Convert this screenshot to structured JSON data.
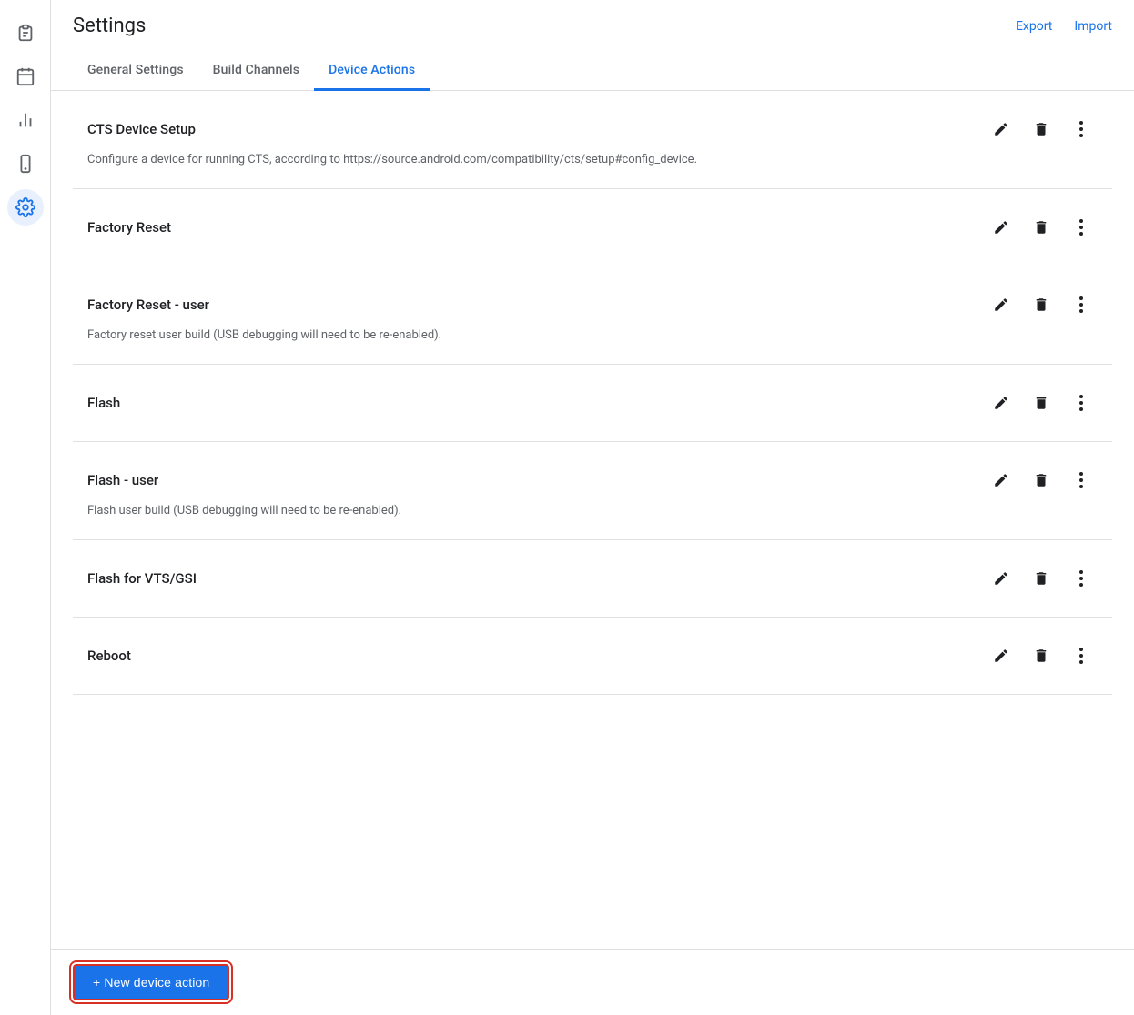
{
  "header": {
    "title": "Settings",
    "export_label": "Export",
    "import_label": "Import"
  },
  "tabs": [
    {
      "id": "general",
      "label": "General Settings",
      "active": false
    },
    {
      "id": "build-channels",
      "label": "Build Channels",
      "active": false
    },
    {
      "id": "device-actions",
      "label": "Device Actions",
      "active": true
    }
  ],
  "sidebar": {
    "icons": [
      {
        "id": "clipboard",
        "symbol": "📋",
        "active": false
      },
      {
        "id": "calendar",
        "symbol": "📅",
        "active": false
      },
      {
        "id": "chart",
        "symbol": "📊",
        "active": false
      },
      {
        "id": "phone",
        "symbol": "📱",
        "active": false
      },
      {
        "id": "settings",
        "symbol": "⚙",
        "active": true
      }
    ]
  },
  "device_actions": [
    {
      "id": "cts-device-setup",
      "title": "CTS Device Setup",
      "description": "Configure a device for running CTS, according to https://source.android.com/compatibility/cts/setup#config_device."
    },
    {
      "id": "factory-reset",
      "title": "Factory Reset",
      "description": ""
    },
    {
      "id": "factory-reset-user",
      "title": "Factory Reset - user",
      "description": "Factory reset user build (USB debugging will need to be re-enabled)."
    },
    {
      "id": "flash",
      "title": "Flash",
      "description": ""
    },
    {
      "id": "flash-user",
      "title": "Flash - user",
      "description": "Flash user build (USB debugging will need to be re-enabled)."
    },
    {
      "id": "flash-vts-gsi",
      "title": "Flash for VTS/GSI",
      "description": ""
    },
    {
      "id": "reboot",
      "title": "Reboot",
      "description": ""
    }
  ],
  "footer": {
    "new_action_label": "+ New device action"
  }
}
